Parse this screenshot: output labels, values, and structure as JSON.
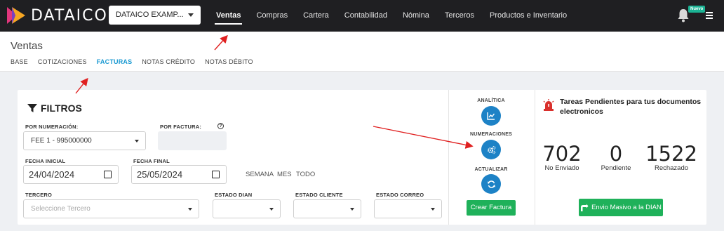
{
  "app": {
    "logo_text": "DATAICO"
  },
  "company_select": {
    "value": "DATAICO EXAMP..."
  },
  "nav": {
    "items": [
      {
        "label": "Ventas",
        "active": true
      },
      {
        "label": "Compras"
      },
      {
        "label": "Cartera"
      },
      {
        "label": "Contabilidad"
      },
      {
        "label": "Nómina"
      },
      {
        "label": "Terceros"
      },
      {
        "label": "Productos e Inventario"
      }
    ],
    "badge": "Nuevo"
  },
  "page": {
    "title": "Ventas",
    "tabs": [
      {
        "label": "BASE"
      },
      {
        "label": "COTIZACIONES"
      },
      {
        "label": "FACTURAS",
        "active": true
      },
      {
        "label": "NOTAS CRÉDITO"
      },
      {
        "label": "NOTAS DÉBITO"
      }
    ]
  },
  "filters": {
    "title": "FILTROS",
    "numeracion": {
      "label": "POR NUMERACIÓN:",
      "value": "FEE 1 - 995000000"
    },
    "factura": {
      "label": "POR FACTURA:",
      "help": "?"
    },
    "fecha_inicial": {
      "label": "FECHA INICIAL",
      "value": "24/04/2024"
    },
    "fecha_final": {
      "label": "FECHA FINAL",
      "value": "25/05/2024"
    },
    "periods": [
      "SEMANA",
      "MES",
      "TODO"
    ],
    "tercero": {
      "label": "TERCERO",
      "placeholder": "Seleccione Tercero"
    },
    "estado_dian": {
      "label": "ESTADO DIAN"
    },
    "estado_cliente": {
      "label": "ESTADO CLIENTE"
    },
    "estado_correo": {
      "label": "ESTADO CORREO"
    }
  },
  "actions": {
    "analitica": "ANALÍTICA",
    "numeraciones": "NUMERACIONES",
    "actualizar": "ACTUALIZAR",
    "crear_factura": "Crear Factura"
  },
  "pending": {
    "title_line1": "Tareas Pendientes para tus documentos",
    "title_line2": "electronicos",
    "stats": [
      {
        "value": "702",
        "label": "No Enviado"
      },
      {
        "value": "0",
        "label": "Pendiente"
      },
      {
        "value": "1522",
        "label": "Rechazado"
      }
    ],
    "button": "Envio Masivo a la DIAN"
  },
  "colors": {
    "topbar": "#1f1f22",
    "accent_blue": "#1d82c6",
    "tab_active": "#1b9ad2",
    "green": "#1fb15a",
    "arrow": "#e02020",
    "alarm": "#d9302c"
  }
}
